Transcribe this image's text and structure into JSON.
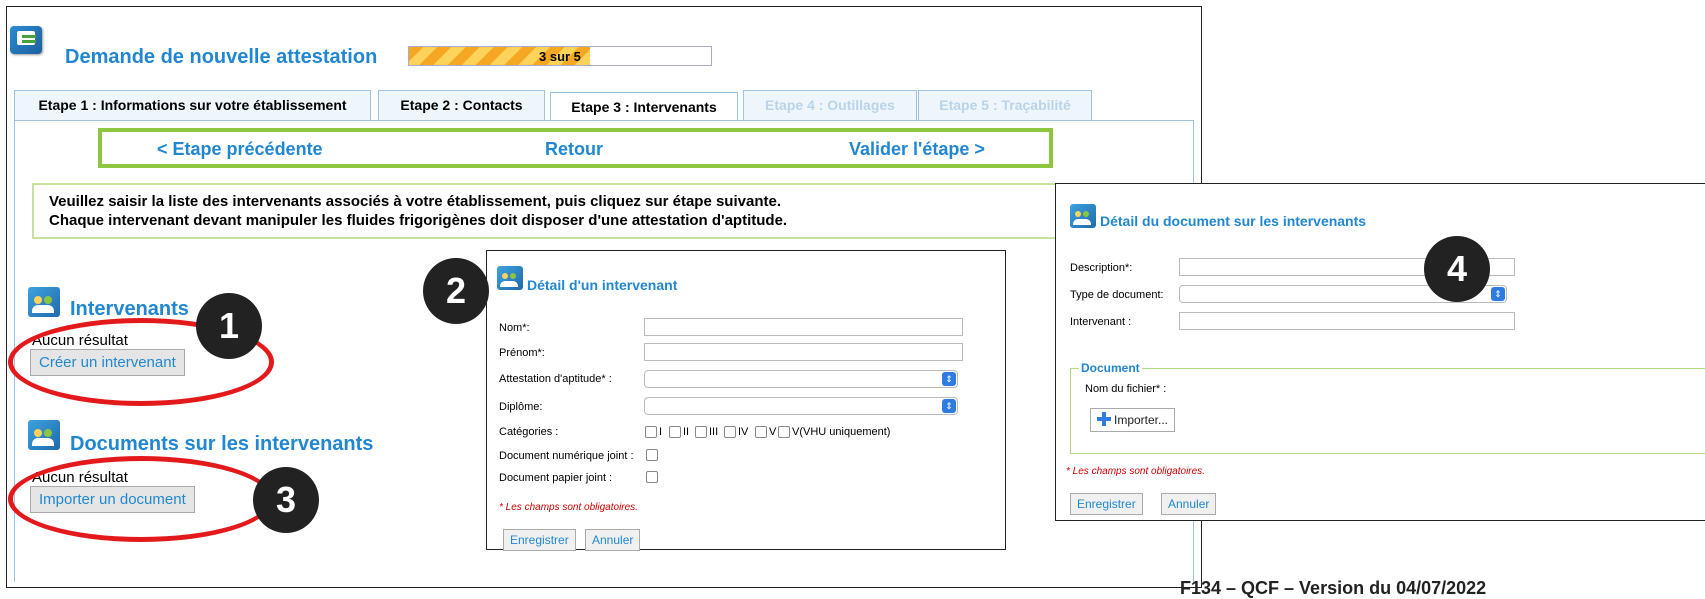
{
  "app": {
    "title": "Demande de nouvelle attestation",
    "progress_text": "3 sur 5",
    "progress_fraction": 0.6
  },
  "tabs": [
    {
      "label": "Etape 1 : Informations sur votre établissement",
      "state": "normal"
    },
    {
      "label": "Etape 2 : Contacts",
      "state": "normal"
    },
    {
      "label": "Etape 3 : Intervenants",
      "state": "active"
    },
    {
      "label": "Etape 4 : Outillages",
      "state": "disabled"
    },
    {
      "label": "Etape 5 : Traçabilité",
      "state": "disabled"
    }
  ],
  "nav": {
    "previous": "< Etape précédente",
    "back": "Retour",
    "validate": "Valider l'étape >"
  },
  "info": {
    "line1": "Veuillez saisir la liste des intervenants associés à votre établissement, puis cliquez sur étape suivante.",
    "line2": "Chaque intervenant devant manipuler les fluides frigorigènes doit disposer d'une attestation d'aptitude."
  },
  "intervenants": {
    "title": "Intervenants",
    "empty": "Aucun résultat",
    "create_button": "Créer un intervenant"
  },
  "documents": {
    "title": "Documents sur les intervenants",
    "empty": "Aucun résultat",
    "import_button": "Importer un document"
  },
  "badges": [
    "1",
    "2",
    "3",
    "4"
  ],
  "dialog_intervenant": {
    "title": "Détail d'un intervenant",
    "fields": {
      "nom": "Nom*:",
      "prenom": "Prénom*:",
      "attestation": "Attestation d'aptitude* :",
      "diplome": "Diplôme:",
      "categories": "Catégories :",
      "doc_numerique": "Document numérique joint :",
      "doc_papier": "Document papier joint :"
    },
    "values": {
      "nom": "",
      "prenom": "",
      "attestation": "",
      "diplome": ""
    },
    "category_options": [
      "I",
      "II",
      "III",
      "IV",
      "V",
      "V(VHU uniquement)"
    ],
    "required_note": "* Les champs sont obligatoires.",
    "save": "Enregistrer",
    "cancel": "Annuler"
  },
  "dialog_document": {
    "title": "Détail du document sur les intervenants",
    "fields": {
      "description": "Description*:",
      "type": "Type de document:",
      "intervenant": "Intervenant :"
    },
    "values": {
      "description": "",
      "type": "",
      "intervenant": ""
    },
    "legend": "Document",
    "filename_label": "Nom du fichier* :",
    "import_button": "Importer...",
    "required_note": "* Les champs sont obligatoires.",
    "save": "Enregistrer",
    "cancel": "Annuler"
  },
  "footer": "F134 – QCF – Version du 04/07/2022",
  "colors": {
    "accent_blue": "#2187d1",
    "nav_green": "#8cc63f",
    "annotation_red": "#e3191b",
    "badge_black": "#222222"
  }
}
